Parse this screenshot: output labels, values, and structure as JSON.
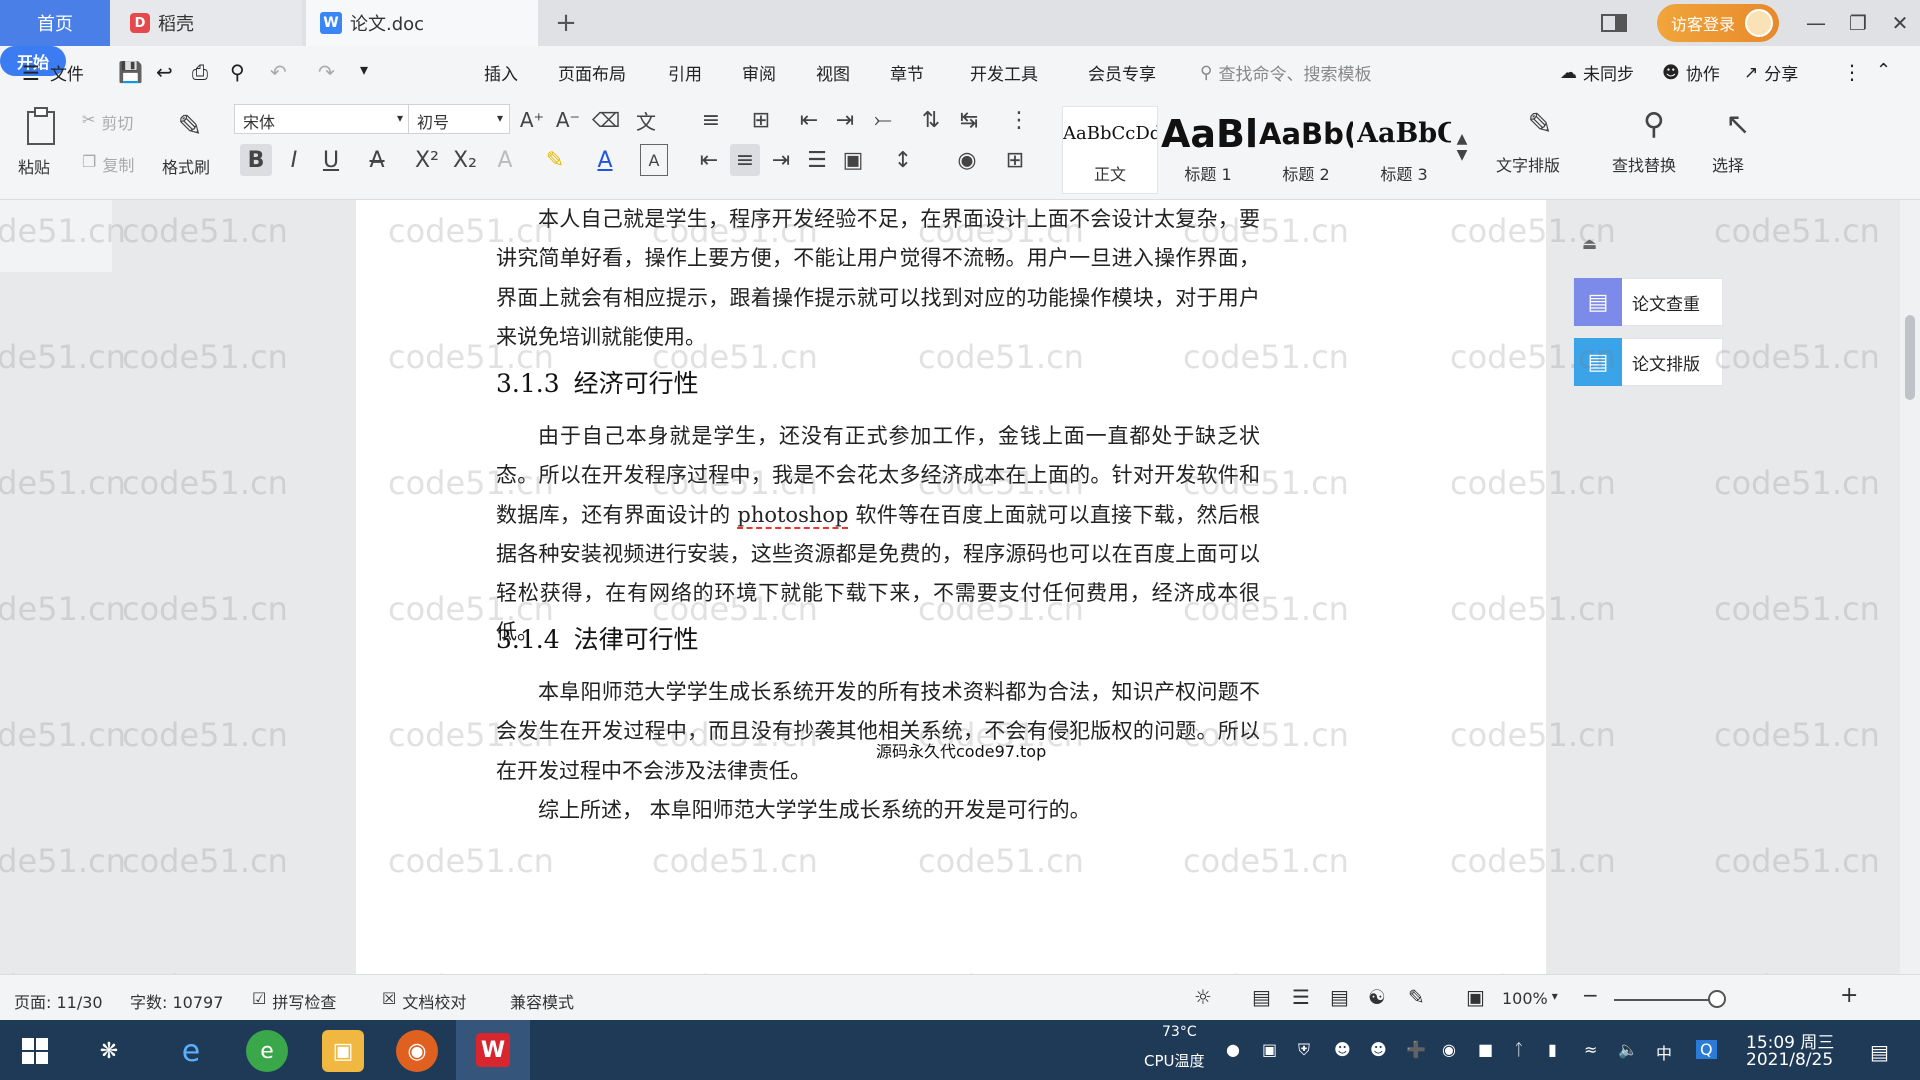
{
  "tabs": {
    "home": "首页",
    "daoke": "稻壳",
    "document": "论文.doc",
    "add": "+"
  },
  "titlebar": {
    "login": "访客登录"
  },
  "menu": {
    "file": "文件",
    "items": [
      "开始",
      "插入",
      "页面布局",
      "引用",
      "审阅",
      "视图",
      "章节",
      "开发工具",
      "会员专享"
    ],
    "search_placeholder": "查找命令、搜索模板",
    "sync": "未同步",
    "collab": "协作",
    "share": "分享"
  },
  "ribbon": {
    "paste": "粘贴",
    "cut": "剪切",
    "copy": "复制",
    "format_painter": "格式刷",
    "font_name": "宋体",
    "font_size": "初号",
    "styles": [
      {
        "sample": "AaBbCcDd",
        "name": "正文"
      },
      {
        "sample": "AaBl",
        "name": "标题 1"
      },
      {
        "sample": "AaBb(",
        "name": "标题 2"
      },
      {
        "sample": "AaBbC",
        "name": "标题 3"
      }
    ],
    "text_layout": "文字排版",
    "find_replace": "查找替换",
    "select": "选择"
  },
  "document": {
    "para1": "本人自己就是学生，程序开发经验不足，在界面设计上面不会设计太复杂，要讲究简单好看，操作上要方便，不能让用户觉得不流畅。用户一旦进入操作界面，界面上就会有相应提示，跟着操作提示就可以找到对应的功能操作模块，对于用户来说免培训就能使用。",
    "h313_num": "3.1.3",
    "h313_title": "经济可行性",
    "para2_a": "由于自己本身就是学生，还没有正式参加工作，金钱上面一直都处于缺乏状态。所以在开发程序过程中，我是不会花太多经济成本在上面的。针对开发软件和数据库，还有界面设计的 ",
    "para2_word": "photoshop",
    "para2_b": " 软件等在百度上面就可以直接下载，然后根据各种安装视频进行安装，这些资源都是免费的，程序源码也可以在百度上面可以轻松获得，在有网络的环境下就能下载下来，不需要支付任何费用，经济成本很低。",
    "overlay": "源码永久代code97.top",
    "h314_num": "3.1.4",
    "h314_title": "法律可行性",
    "para3": "本阜阳师范大学学生成长系统开发的所有技术资料都为合法，知识产权问题不会发生在开发过程中，而且没有抄袭其他相关系统，不会有侵犯版权的问题。所以在开发过程中不会涉及法律责任。",
    "para4": "综上所述， 本阜阳师范大学学生成长系统的开发是可行的。"
  },
  "side_panel": {
    "check": "论文查重",
    "layout": "论文排版"
  },
  "watermark": "code51.cn",
  "status": {
    "page": "页面: 11/30",
    "words": "字数: 10797",
    "spell": "拼写检查",
    "proof": "文档校对",
    "compat": "兼容模式",
    "zoom": "100%"
  },
  "taskbar": {
    "temp": "73°C",
    "cpu": "CPU温度",
    "ime": "中",
    "time": "15:09 周三",
    "date": "2021/8/25"
  }
}
